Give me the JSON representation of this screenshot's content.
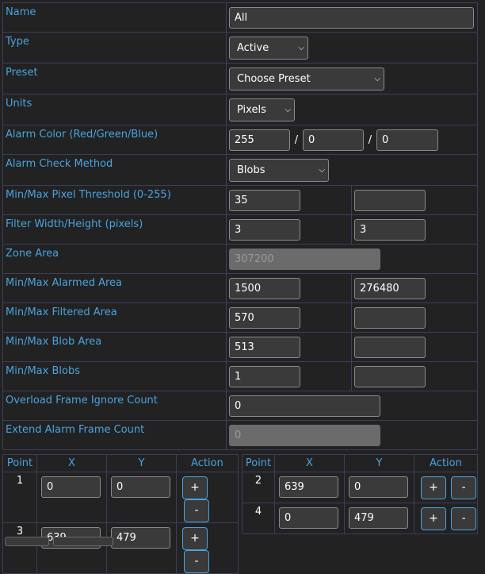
{
  "fields": {
    "name": {
      "label": "Name",
      "value": "All"
    },
    "type": {
      "label": "Type",
      "value": "Active"
    },
    "preset": {
      "label": "Preset",
      "value": "Choose Preset"
    },
    "units": {
      "label": "Units",
      "value": "Pixels"
    },
    "alarm_color": {
      "label": "Alarm Color (Red/Green/Blue)",
      "red": "255",
      "green": "0",
      "blue": "0",
      "separator": "/"
    },
    "alarm_check_method": {
      "label": "Alarm Check Method",
      "value": "Blobs"
    },
    "pixel_threshold": {
      "label": "Min/Max Pixel Threshold (0-255)",
      "min": "35",
      "max": ""
    },
    "filter_size": {
      "label": "Filter Width/Height (pixels)",
      "width": "3",
      "height": "3"
    },
    "zone_area": {
      "label": "Zone Area",
      "value": "307200"
    },
    "alarmed_area": {
      "label": "Min/Max Alarmed Area",
      "min": "1500",
      "max": "276480"
    },
    "filtered_area": {
      "label": "Min/Max Filtered Area",
      "min": "570",
      "max": ""
    },
    "blob_area": {
      "label": "Min/Max Blob Area",
      "min": "513",
      "max": ""
    },
    "blobs": {
      "label": "Min/Max Blobs",
      "min": "1",
      "max": ""
    },
    "overload_ignore": {
      "label": "Overload Frame Ignore Count",
      "value": "0"
    },
    "extend_alarm": {
      "label": "Extend Alarm Frame Count",
      "value": "0"
    }
  },
  "points": {
    "headers": {
      "point": "Point",
      "x": "X",
      "y": "Y",
      "action": "Action"
    },
    "add_label": "+",
    "remove_label": "-",
    "items": [
      {
        "index": "1",
        "x": "0",
        "y": "0"
      },
      {
        "index": "2",
        "x": "639",
        "y": "0"
      },
      {
        "index": "3",
        "x": "639",
        "y": "479"
      },
      {
        "index": "4",
        "x": "0",
        "y": "479"
      }
    ]
  },
  "colors": {
    "label": "#4aa3df",
    "background": "#222222",
    "border": "#3d3d5c"
  }
}
